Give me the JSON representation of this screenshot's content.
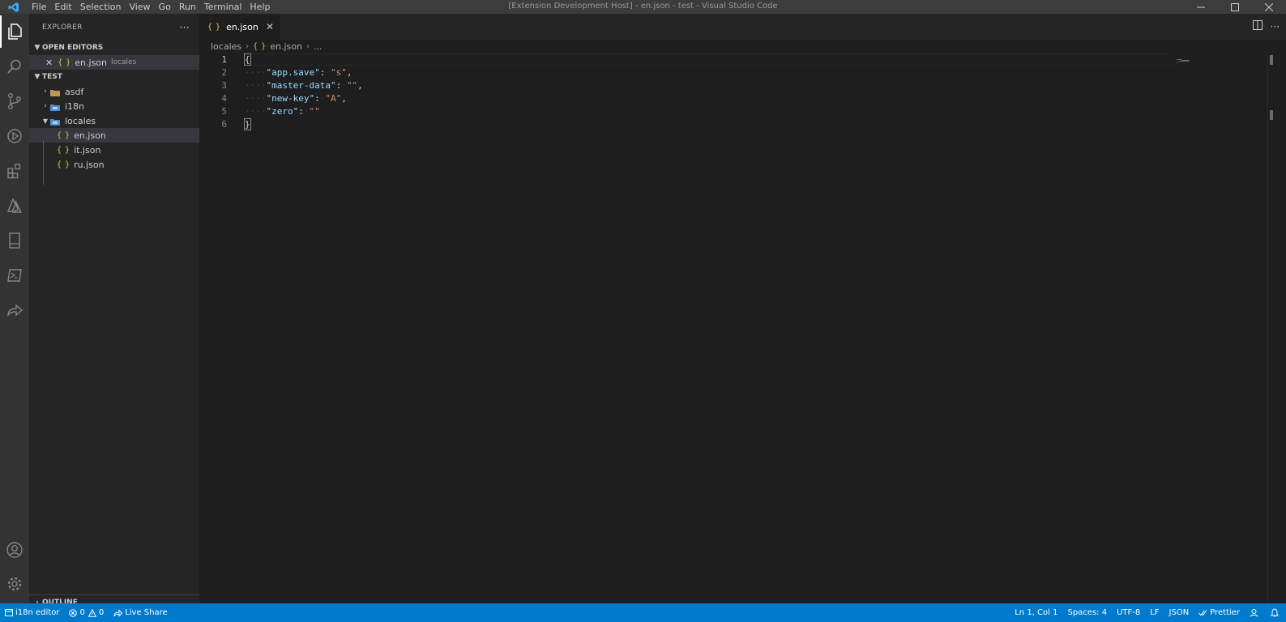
{
  "window": {
    "title": "[Extension Development Host] - en.json - test - Visual Studio Code",
    "menu": [
      "File",
      "Edit",
      "Selection",
      "View",
      "Go",
      "Run",
      "Terminal",
      "Help"
    ]
  },
  "activitybar": {
    "items": [
      "explorer-icon",
      "search-icon",
      "source-control-icon",
      "run-debug-icon",
      "extensions-icon",
      "azure-icon",
      "remote-explorer-icon",
      "powershell-icon",
      "live-share-icon"
    ],
    "bottom": [
      "account-icon",
      "manage-gear-icon"
    ]
  },
  "sidebar": {
    "title": "EXPLORER",
    "more": "···",
    "open_editors": {
      "header": "OPEN EDITORS",
      "items": [
        {
          "name": "en.json",
          "folder": "locales"
        }
      ]
    },
    "workspace": {
      "header": "TEST",
      "folders": [
        {
          "name": "asdf",
          "expanded": false
        },
        {
          "name": "i18n",
          "expanded": false
        },
        {
          "name": "locales",
          "expanded": true
        }
      ],
      "files": [
        "en.json",
        "it.json",
        "ru.json"
      ]
    },
    "outline": "OUTLINE"
  },
  "tabs": [
    {
      "label": "en.json",
      "icon": "{ }",
      "active": true
    }
  ],
  "breadcrumb": {
    "folder": "locales",
    "file": "en.json",
    "more": "..."
  },
  "editor": {
    "line_numbers": [
      "1",
      "2",
      "3",
      "4",
      "5",
      "6"
    ],
    "active_line": 1,
    "lines": [
      {
        "tokens": [
          {
            "t": "{",
            "c": "punc brace-hl"
          }
        ]
      },
      {
        "tokens": [
          {
            "t": "····",
            "c": "ws"
          },
          {
            "t": "\"app.save\"",
            "c": "key"
          },
          {
            "t": ":",
            "c": "punc"
          },
          {
            "t": "·",
            "c": "ws"
          },
          {
            "t": "\"s\"",
            "c": "str"
          },
          {
            "t": ",",
            "c": "punc"
          }
        ]
      },
      {
        "tokens": [
          {
            "t": "····",
            "c": "ws"
          },
          {
            "t": "\"master-data\"",
            "c": "key"
          },
          {
            "t": ":",
            "c": "punc"
          },
          {
            "t": "·",
            "c": "ws"
          },
          {
            "t": "\"\"",
            "c": "str"
          },
          {
            "t": ",",
            "c": "punc"
          }
        ]
      },
      {
        "tokens": [
          {
            "t": "····",
            "c": "ws"
          },
          {
            "t": "\"new-key\"",
            "c": "key"
          },
          {
            "t": ":",
            "c": "punc"
          },
          {
            "t": "·",
            "c": "ws"
          },
          {
            "t": "\"A\"",
            "c": "str"
          },
          {
            "t": ",",
            "c": "punc"
          }
        ]
      },
      {
        "tokens": [
          {
            "t": "····",
            "c": "ws"
          },
          {
            "t": "\"zero\"",
            "c": "key"
          },
          {
            "t": ":",
            "c": "punc"
          },
          {
            "t": "·",
            "c": "ws"
          },
          {
            "t": "\"\"",
            "c": "str"
          }
        ]
      },
      {
        "tokens": [
          {
            "t": "}",
            "c": "punc brace-hl"
          }
        ]
      }
    ]
  },
  "statusbar": {
    "i18n": "i18n editor",
    "errors": "0",
    "warnings": "0",
    "live_share": "Live Share",
    "position": "Ln 1, Col 1",
    "spaces": "Spaces: 4",
    "encoding": "UTF-8",
    "eol": "LF",
    "language": "JSON",
    "prettier": "Prettier"
  },
  "colors": {
    "accent": "#007acc",
    "json_icon": "#cbcb41",
    "key": "#9cdcfe",
    "string": "#ce9178"
  }
}
